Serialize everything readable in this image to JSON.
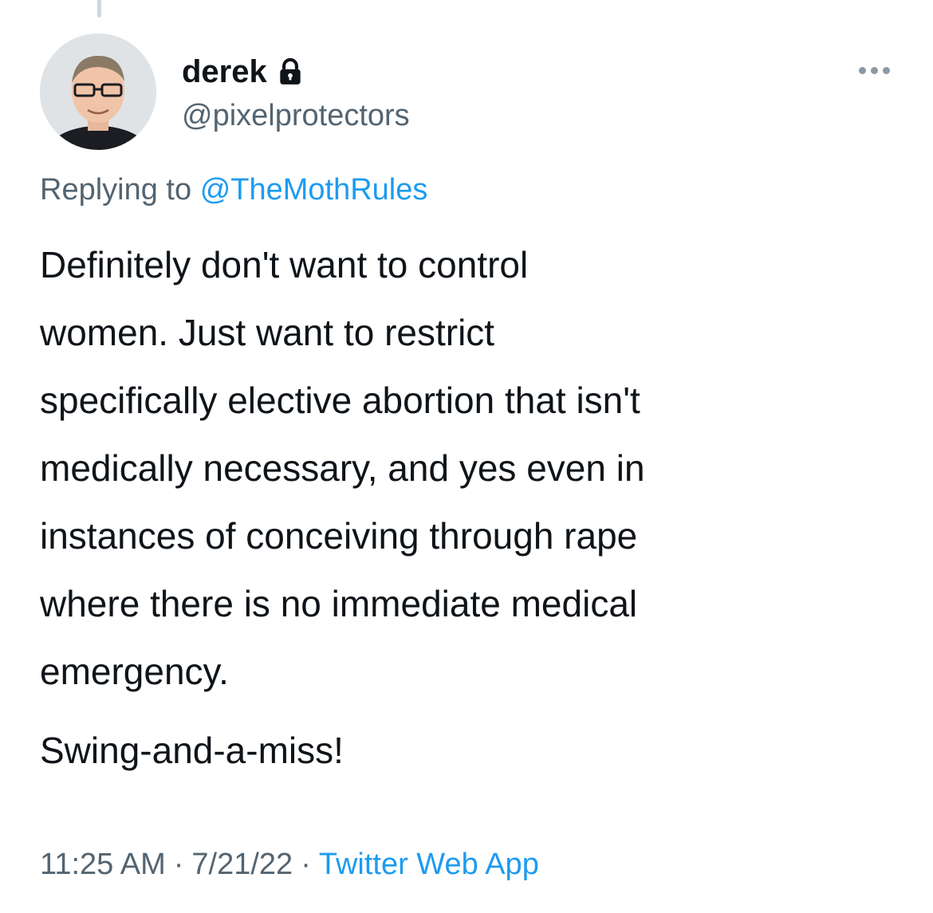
{
  "tweet": {
    "author": {
      "display_name": "derek",
      "handle": "@pixelprotectors",
      "protected_icon": "lock-icon"
    },
    "reply": {
      "prefix": "Replying to",
      "mention": "@TheMothRules"
    },
    "body_lines": [
      "Definitely don't want to control",
      "women. Just want to restrict",
      "specifically elective abortion that isn't",
      "medically necessary, and yes even in",
      "instances of conceiving through rape",
      "where there is no immediate medical",
      "emergency."
    ],
    "body_followup": "Swing-and-a-miss!",
    "meta": {
      "time": "11:25 AM",
      "separator": "·",
      "date": "7/21/22",
      "source": "Twitter Web App"
    }
  },
  "colors": {
    "text_primary": "#0f1419",
    "text_secondary": "#536471",
    "link": "#1d9bf0"
  }
}
